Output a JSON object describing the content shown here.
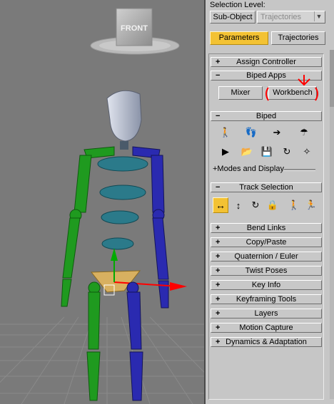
{
  "viewport": {
    "viewcube_label": "FRONT",
    "annotation_color": "#ff0000"
  },
  "panel": {
    "selection_level_label": "Selection Level:",
    "sub_object_label": "Sub-Object",
    "sub_object_value": "Trajectories",
    "tabs": {
      "parameters": "Parameters",
      "trajectories": "Trajectories"
    },
    "rollouts_top": [
      {
        "sign": "+",
        "label": "Assign Controller"
      },
      {
        "sign": "−",
        "label": "Biped Apps"
      }
    ],
    "biped_apps": {
      "mixer": "Mixer",
      "workbench": "Workbench"
    },
    "biped_rollout": {
      "sign": "−",
      "label": "Biped"
    },
    "biped_row1_icons": [
      "figure-mode-icon",
      "footsteps-icon",
      "motion-flow-icon",
      "mixer-mode-icon"
    ],
    "biped_row2_icons": [
      "play-biped-icon",
      "open-file-icon",
      "save-file-icon",
      "load-file-icon",
      "snap-icon"
    ],
    "modes_and_display": "+Modes and Display",
    "track_selection_rollout": {
      "sign": "−",
      "label": "Track Selection"
    },
    "track_icons": [
      "body-horizontal-icon",
      "body-vertical-icon",
      "body-rotation-icon",
      "lock-cob-icon",
      "symmetrical-icon",
      "opposite-icon"
    ],
    "rollouts_bottom": [
      {
        "sign": "+",
        "label": "Bend Links"
      },
      {
        "sign": "+",
        "label": "Copy/Paste"
      },
      {
        "sign": "+",
        "label": "Quaternion / Euler"
      },
      {
        "sign": "+",
        "label": "Twist Poses"
      },
      {
        "sign": "+",
        "label": "Key Info"
      },
      {
        "sign": "+",
        "label": "Keyframing Tools"
      },
      {
        "sign": "+",
        "label": "Layers"
      },
      {
        "sign": "+",
        "label": "Motion Capture"
      },
      {
        "sign": "+",
        "label": "Dynamics & Adaptation"
      }
    ],
    "accent_color": "#f3c233"
  }
}
